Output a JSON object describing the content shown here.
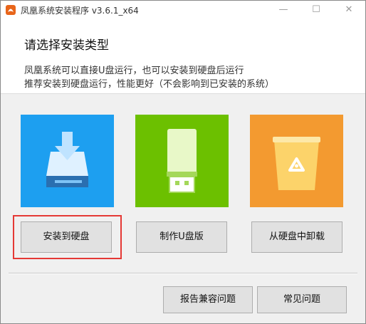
{
  "window": {
    "title": "凤凰系统安装程序 v3.6.1_x64",
    "min_icon": "—",
    "max_icon": "☐",
    "close_icon": "✕"
  },
  "header": {
    "heading": "请选择安装类型",
    "line1": "凤凰系统可以直接U盘运行，也可以安装到硬盘后运行",
    "line2": "推荐安装到硬盘运行，性能更好（不会影响到已安装的系统）"
  },
  "options": [
    {
      "label": "安装到硬盘",
      "icon": "hard-drive-download-icon",
      "color": "#1d9ff0"
    },
    {
      "label": "制作U盘版",
      "icon": "usb-drive-icon",
      "color": "#6cc000"
    },
    {
      "label": "从硬盘中卸载",
      "icon": "recycle-bin-icon",
      "color": "#f39a30"
    }
  ],
  "footer": {
    "report_label": "报告兼容问题",
    "faq_label": "常见问题"
  },
  "colors": {
    "highlight": "#e53935",
    "background": "#f0f0f0"
  }
}
